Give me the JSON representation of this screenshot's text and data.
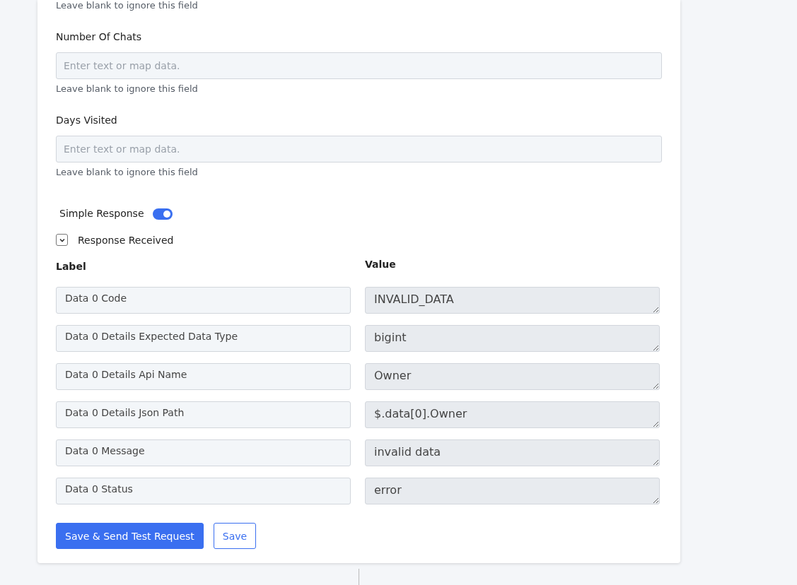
{
  "top_hint": "Leave blank to ignore this field",
  "fields": [
    {
      "label": "Number Of Chats",
      "placeholder": "Enter text or map data.",
      "hint": "Leave blank to ignore this field"
    },
    {
      "label": "Days Visited",
      "placeholder": "Enter text or map data.",
      "hint": "Leave blank to ignore this field"
    }
  ],
  "simple_response": {
    "label": "Simple Response",
    "on": true
  },
  "response_received": {
    "label": "Response Received",
    "expanded": true
  },
  "columns": [
    "Label",
    "Value"
  ],
  "rows": [
    {
      "label": "Data 0 Code",
      "value": "INVALID_DATA"
    },
    {
      "label": "Data 0 Details Expected Data Type",
      "value": "bigint"
    },
    {
      "label": "Data 0 Details Api Name",
      "value": "Owner"
    },
    {
      "label": "Data 0 Details Json Path",
      "value": "$.data[0].Owner"
    },
    {
      "label": "Data 0 Message",
      "value": "invalid data"
    },
    {
      "label": "Data 0 Status",
      "value": "error"
    }
  ],
  "buttons": [
    {
      "label": "Save & Send Test Request",
      "kind": "primary"
    },
    {
      "label": "Save",
      "kind": "secondary"
    }
  ]
}
